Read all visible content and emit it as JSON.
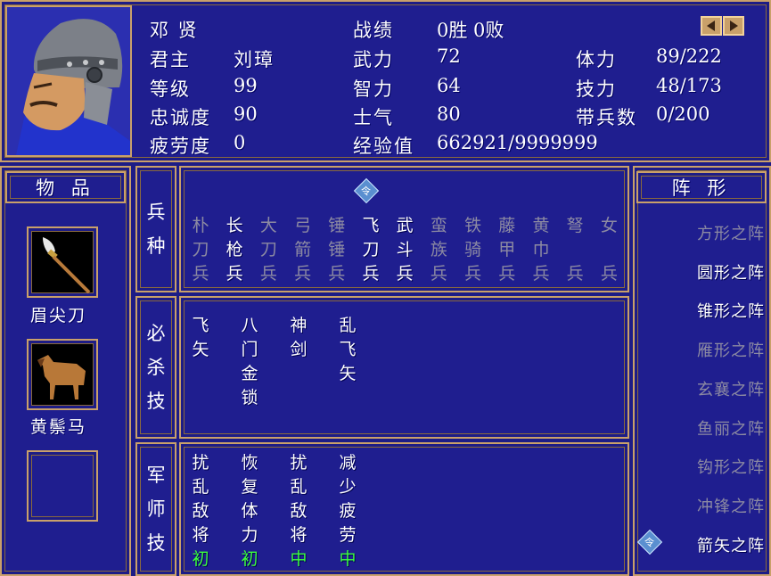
{
  "general": {
    "name": "邓 贤",
    "lord_label": "君主",
    "lord": "刘璋",
    "level_label": "等级",
    "level": "99",
    "loyalty_label": "忠诚度",
    "loyalty": "90",
    "fatigue_label": "疲劳度",
    "fatigue": "0",
    "record_label": "战绩",
    "record": "0胜 0败",
    "force_label": "武力",
    "force": "72",
    "intellect_label": "智力",
    "intellect": "64",
    "morale_label": "士气",
    "morale": "80",
    "exp_label": "经验值",
    "exp": "662921/9999999",
    "hp_label": "体力",
    "hp": "89/222",
    "skill_label": "技力",
    "skill": "48/173",
    "troops_label": "带兵数",
    "troops": "0/200"
  },
  "items": {
    "title": "物 品",
    "item1": "眉尖刀",
    "item2": "黄鬃马"
  },
  "troop_types": {
    "label": [
      "兵",
      "种"
    ],
    "columns": [
      {
        "chars": [
          "朴",
          "刀",
          "兵"
        ],
        "active": false
      },
      {
        "chars": [
          "长",
          "枪",
          "兵"
        ],
        "active": true
      },
      {
        "chars": [
          "大",
          "刀",
          "兵"
        ],
        "active": false
      },
      {
        "chars": [
          "弓",
          "箭",
          "兵"
        ],
        "active": false
      },
      {
        "chars": [
          "锤",
          "锤",
          "兵"
        ],
        "active": false
      },
      {
        "chars": [
          "飞",
          "刀",
          "兵"
        ],
        "active": true
      },
      {
        "chars": [
          "武",
          "斗",
          "兵"
        ],
        "active": true
      },
      {
        "chars": [
          "蛮",
          "族",
          "兵"
        ],
        "active": false
      },
      {
        "chars": [
          "铁",
          "骑",
          "兵"
        ],
        "active": false
      },
      {
        "chars": [
          "藤",
          "甲",
          "兵"
        ],
        "active": false
      },
      {
        "chars": [
          "黄",
          "巾",
          "兵"
        ],
        "active": false
      },
      {
        "chars": [
          "弩",
          "",
          "兵"
        ],
        "active": false
      },
      {
        "chars": [
          "女",
          "",
          "兵"
        ],
        "active": false
      }
    ]
  },
  "special_skills": {
    "label": [
      "必",
      "杀",
      "技"
    ],
    "columns": [
      [
        "飞",
        "矢"
      ],
      [
        "八",
        "门",
        "金",
        "锁"
      ],
      [
        "神",
        "剑"
      ],
      [
        "乱",
        "飞",
        "矢"
      ]
    ]
  },
  "strategist_skills": {
    "label": [
      "军",
      "师",
      "技"
    ],
    "columns": [
      {
        "chars": [
          "扰",
          "乱",
          "敌",
          "将"
        ],
        "grade": "初"
      },
      {
        "chars": [
          "恢",
          "复",
          "体",
          "力"
        ],
        "grade": "初"
      },
      {
        "chars": [
          "扰",
          "乱",
          "敌",
          "将"
        ],
        "grade": "中"
      },
      {
        "chars": [
          "减",
          "少",
          "疲",
          "劳"
        ],
        "grade": "中"
      }
    ]
  },
  "formations": {
    "title": "阵 形",
    "list": [
      {
        "name": "方形之阵",
        "active": false
      },
      {
        "name": "圆形之阵",
        "active": true
      },
      {
        "name": "锥形之阵",
        "active": true
      },
      {
        "name": "雁形之阵",
        "active": false
      },
      {
        "name": "玄襄之阵",
        "active": false
      },
      {
        "name": "鱼丽之阵",
        "active": false
      },
      {
        "name": "钩形之阵",
        "active": false
      },
      {
        "name": "冲锋之阵",
        "active": false
      },
      {
        "name": "箭矢之阵",
        "active": true
      }
    ]
  },
  "selector_glyph": "令",
  "colors": {
    "background": "#1d1c86",
    "border": "#c9a06a",
    "dim_text": "#8c8aa2",
    "grade_green": "#3cff3c"
  }
}
